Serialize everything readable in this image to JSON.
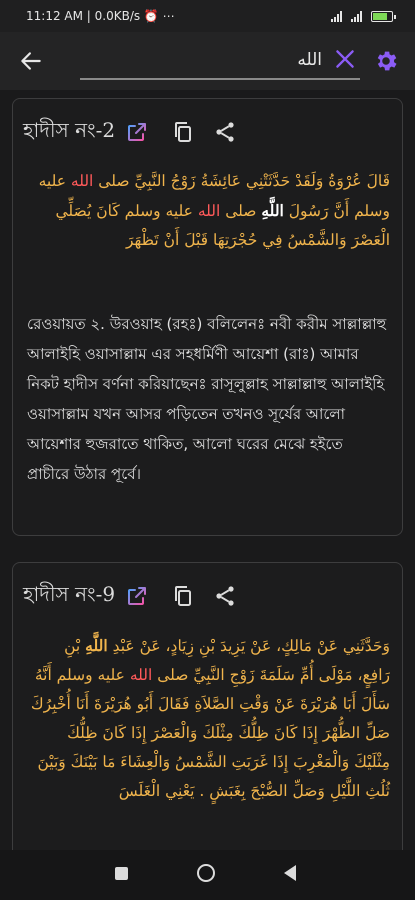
{
  "status_bar": {
    "time": "11:12 AM | 0.0KB/s ⏰ ⋯",
    "battery_level": 0.8,
    "battery_text": "81"
  },
  "app_bar": {
    "search_value": "الله",
    "accent_color": "#7e57ff"
  },
  "cards": [
    {
      "hadith_number": "হাদীস নং-2",
      "arabic_parts": [
        "قَالَ عُرْوَةُ وَلَقَدْ حَدَّثَتْنِي عَائِشَةُ زَوْجُ النَّبِيِّ صلى ",
        "الله",
        " عليه وسلم أَنَّ رَسُولَ ",
        "اللَّهِ",
        " صلى ",
        "الله",
        " عليه وسلم كَانَ يُصَلِّي الْعَصْرَ وَالشَّمْسُ فِي حُجْرَتِهَا قَبْلَ أَنْ تَظْهَرَ"
      ],
      "bangla": "রেওয়ায়ত ২. উরওয়াহ (রহঃ) বলিলেনঃ নবী করীম সাল্লাল্লাহু আলাইহি ওয়াসাল্লাম এর সহধর্মিণী আয়েশা (রাঃ) আমার নিকট হাদীস বর্ণনা করিয়াছেনঃ রাসূলুল্লাহ সাল্লাল্লাহু আলাইহি ওয়াসাল্লাম যখন আসর পড়িতেন তখনও সূর্যের আলো আয়েশার হুজরাতে থাকিত, আলো ঘরের মেঝে হইতে প্রাচীরে উঠার পূর্বে।"
    },
    {
      "hadith_number": "হাদীস নং-9",
      "arabic_parts": [
        "وَحَدَّثَنِي عَنْ مَالِكٍ، عَنْ يَزِيدَ بْنِ زِيَادٍ، عَنْ عَبْدِ ",
        "اللَّهِ",
        " بْنِ رَافِعٍ، مَوْلَى أُمِّ سَلَمَةَ زَوْجِ النَّبِيِّ صلى ",
        "الله",
        " عليه وسلم أَنَّهُ سَأَلَ أَبَا هُرَيْرَةَ عَنْ وَقْتِ الصَّلاَةِ فَقَالَ أَبُو هُرَيْرَةَ أَنَا أُخْبِرُكَ صَلِّ الظُّهْرَ إِذَا كَانَ ظِلُّكَ مِثْلَكَ وَالْعَصْرَ إِذَا كَانَ ظِلُّكَ مِثْلَيْكَ وَالْمَغْرِبَ إِذَا غَرَبَتِ الشَّمْسُ وَالْعِشَاءَ مَا بَيْنَكَ وَبَيْنَ ثُلُثِ اللَّيْلِ وَصَلِّ الصُّبْحَ بِغَبَشٍ . يَعْنِي الْغَلَسَ"
      ]
    }
  ]
}
